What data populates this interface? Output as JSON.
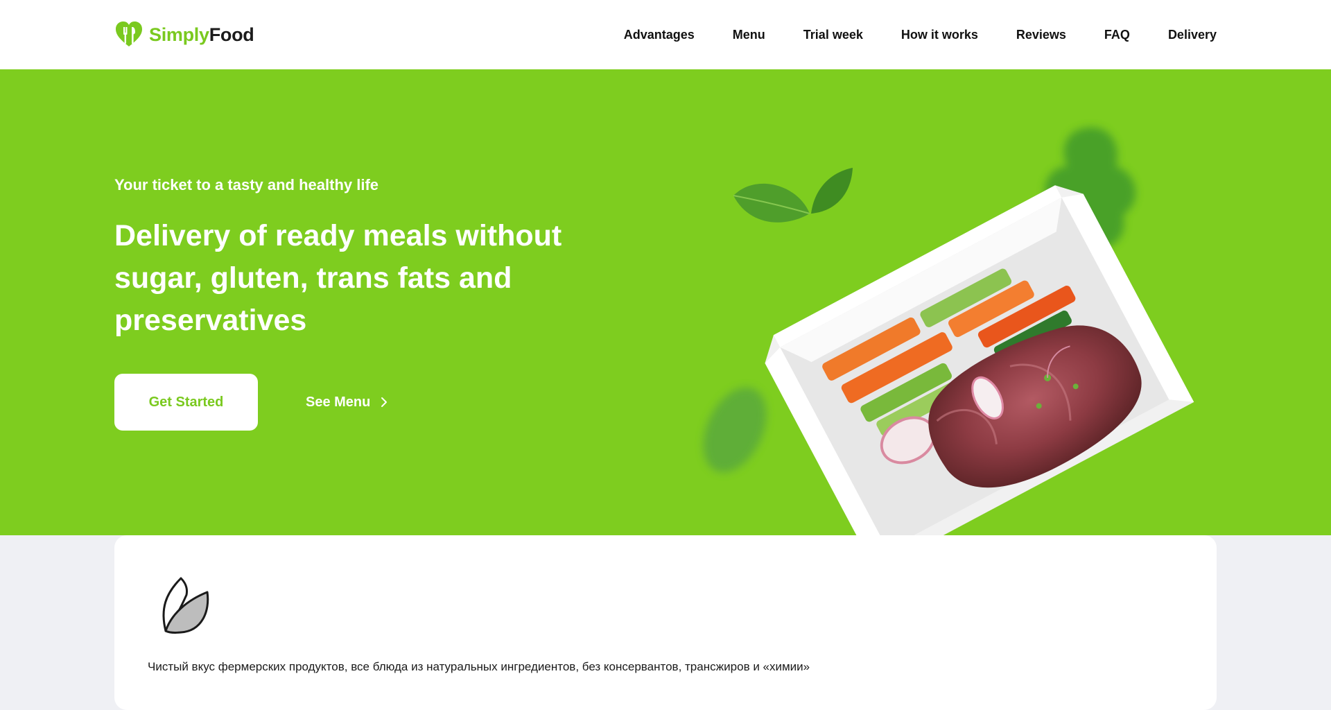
{
  "brand": {
    "name_part1": "Simply",
    "name_part2": "Food",
    "accent_color": "#7ac91f",
    "logo_icon": "heart-cutlery-icon"
  },
  "nav": {
    "items": [
      {
        "label": "Advantages"
      },
      {
        "label": "Menu"
      },
      {
        "label": "Trial week"
      },
      {
        "label": "How it works"
      },
      {
        "label": "Reviews"
      },
      {
        "label": "FAQ"
      },
      {
        "label": "Delivery"
      }
    ]
  },
  "hero": {
    "kicker": "Your ticket to a tasty and healthy life",
    "title": "Delivery of ready meals without sugar, gluten, trans fats and preservatives",
    "primary_button": "Get Started",
    "secondary_button": "See Menu",
    "secondary_icon": "chevron-right-icon",
    "background_color": "#7ecd1f"
  },
  "features": {
    "items": [
      {
        "icon": "leaf-icon",
        "text": "Чистый вкус фермерских продуктов, все блюда из натуральных ингредиентов, без консервантов, трансжиров и «химии»"
      }
    ]
  }
}
